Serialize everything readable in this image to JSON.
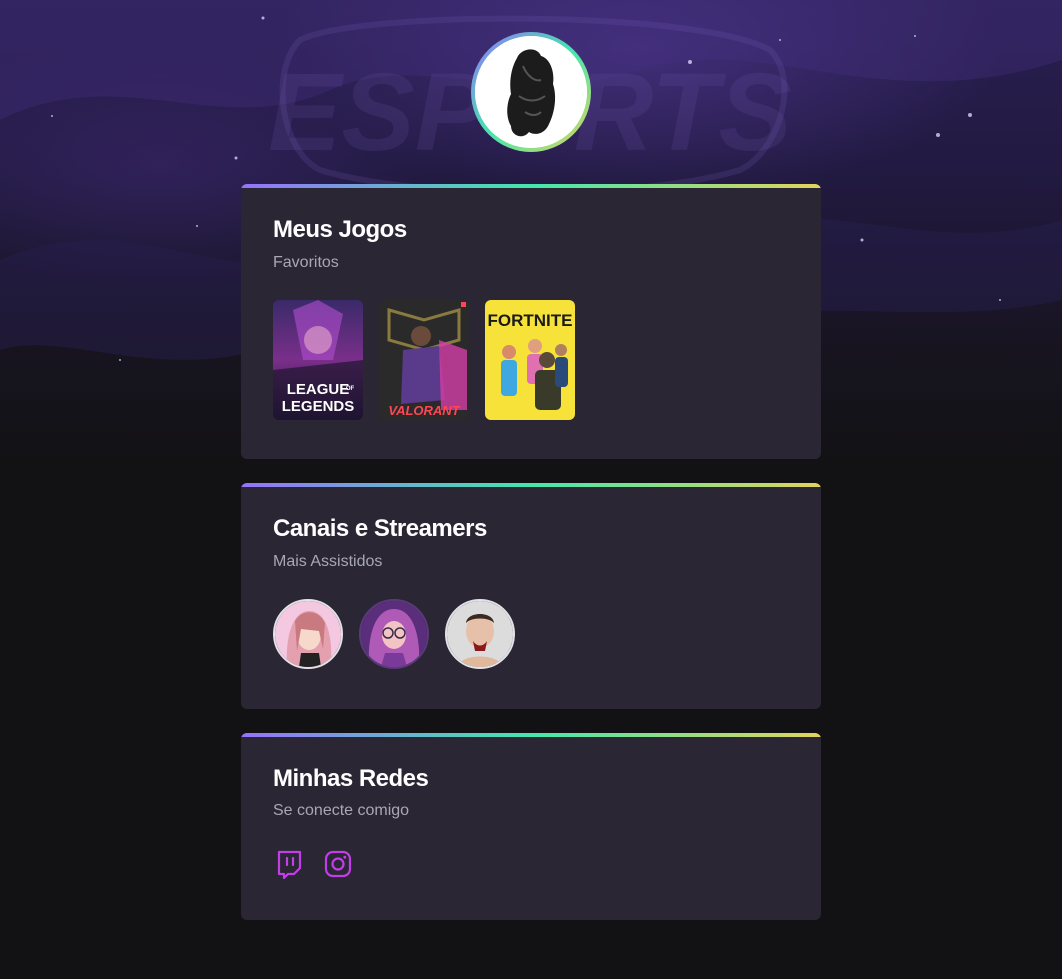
{
  "profile": {
    "avatar_alt": ""
  },
  "games_section": {
    "title": "Meus Jogos",
    "subtitle": "Favoritos",
    "games": [
      {
        "line1": "LEAGUE",
        "of": "OF",
        "line2": "LEGENDS"
      },
      {
        "name": "VALORANT"
      },
      {
        "name": "FORTNITE"
      }
    ]
  },
  "streamers_section": {
    "title": "Canais e Streamers",
    "subtitle": "Mais Assistidos"
  },
  "social_section": {
    "title": "Minhas Redes",
    "subtitle": "Se conecte comigo",
    "icons": [
      "twitch-icon",
      "instagram-icon"
    ]
  },
  "colors": {
    "accent_gradient": [
      "#9572fc",
      "#43e7ad",
      "#e2d45c"
    ],
    "card_bg": "#2a2634",
    "social_icon": "#c13ee8"
  }
}
